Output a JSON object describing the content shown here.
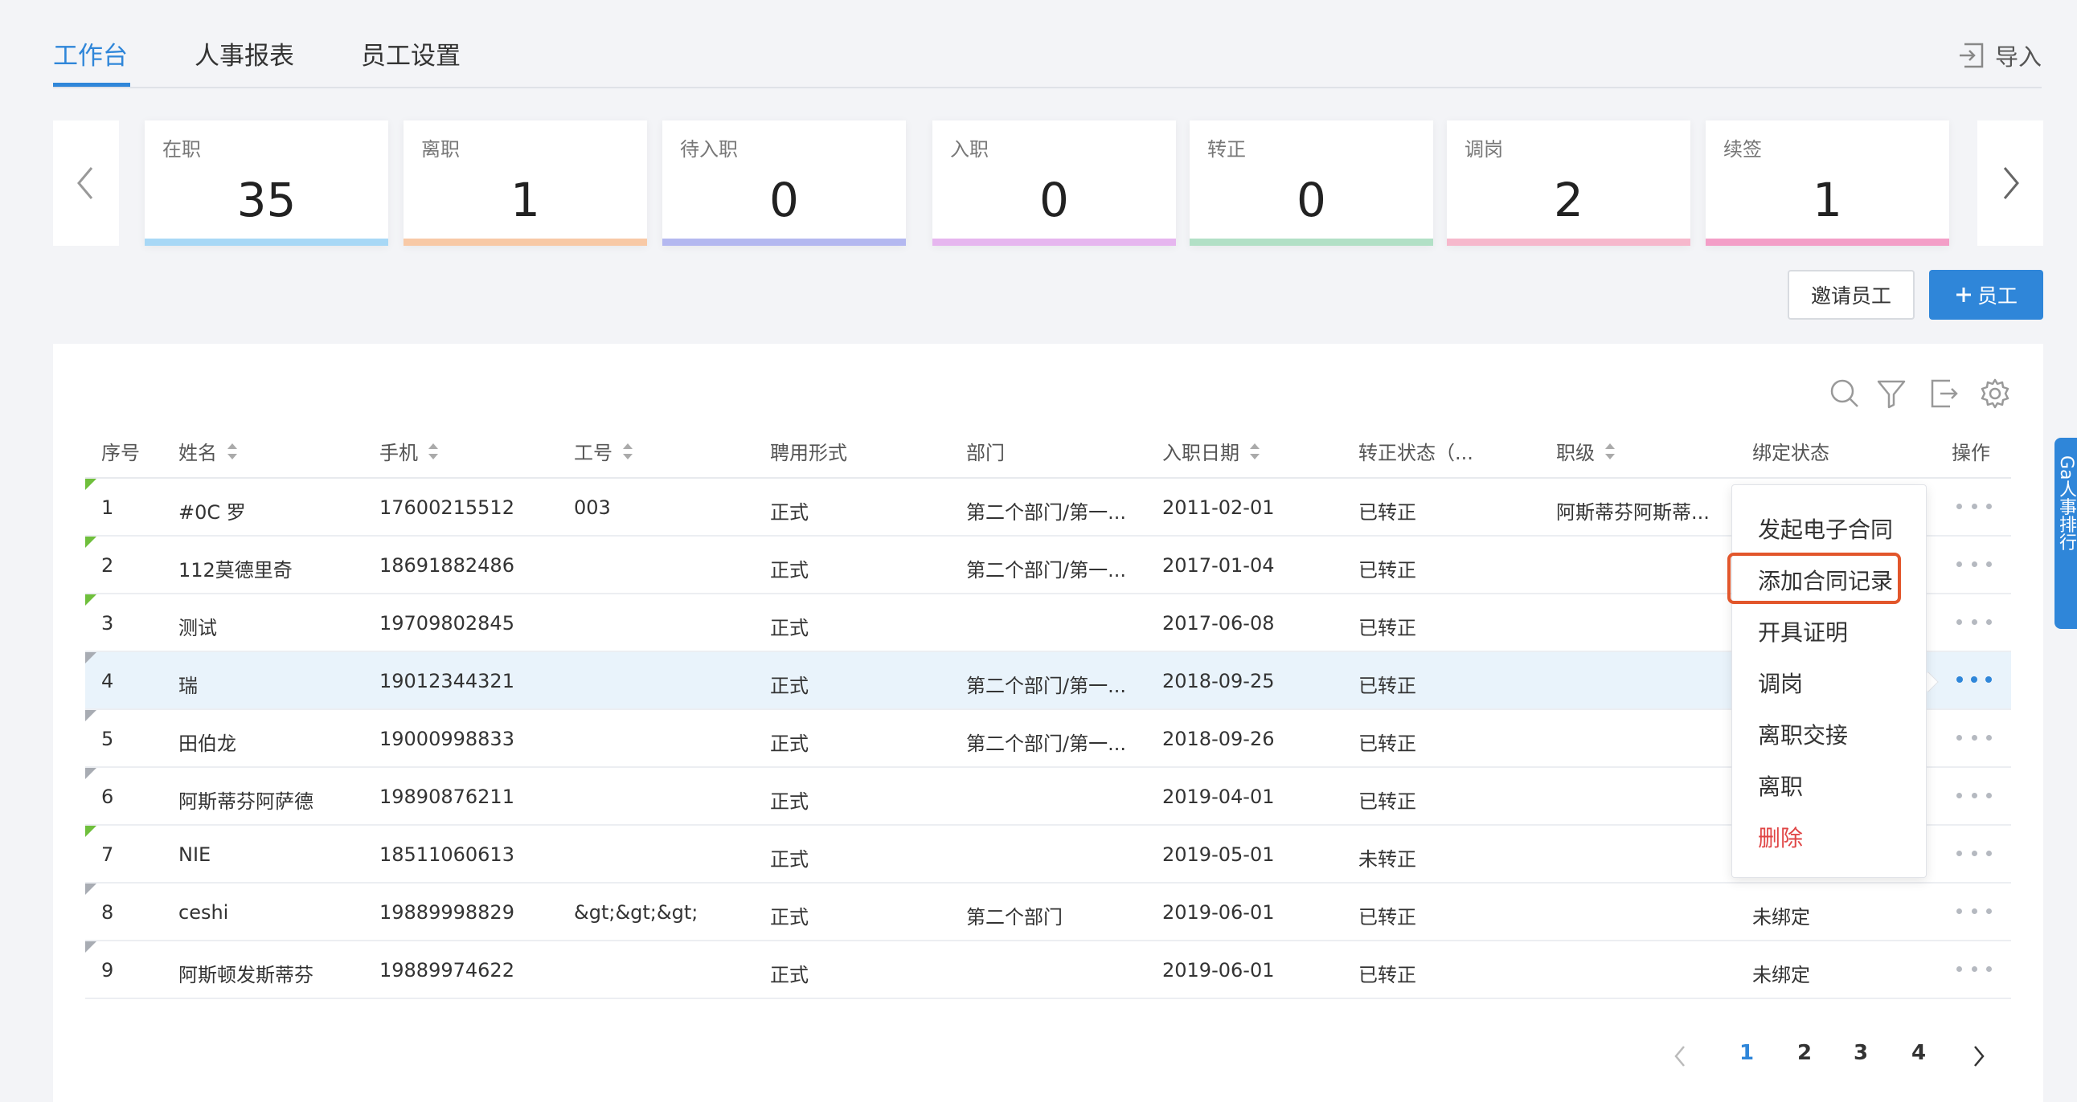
{
  "tabs": [
    {
      "label": "工作台",
      "active": true
    },
    {
      "label": "人事报表",
      "active": false
    },
    {
      "label": "员工设置",
      "active": false
    }
  ],
  "import_label": "导入",
  "stats": [
    {
      "label": "在职",
      "value": "35",
      "color": "#a8d8f6"
    },
    {
      "label": "离职",
      "value": "1",
      "color": "#f8c9a6"
    },
    {
      "label": "待入职",
      "value": "0",
      "color": "#b4b8f0"
    },
    {
      "label": "入职",
      "value": "0",
      "color": "#e6b6ef"
    },
    {
      "label": "转正",
      "value": "0",
      "color": "#b2e0c6"
    },
    {
      "label": "调岗",
      "value": "2",
      "color": "#f6b8cc"
    },
    {
      "label": "续签",
      "value": "1",
      "color": "#f39ec7"
    }
  ],
  "buttons": {
    "invite": "邀请员工",
    "add": "员工",
    "add_icon": "plus-icon"
  },
  "toolbar_icons": [
    "search-icon",
    "filter-icon",
    "export-icon",
    "settings-icon"
  ],
  "columns": [
    "序号",
    "姓名",
    "手机",
    "工号",
    "聘用形式",
    "部门",
    "入职日期",
    "转正状态（...",
    "职级",
    "绑定状态",
    "操作"
  ],
  "rows": [
    {
      "no": "1",
      "name": "#0C 罗",
      "phone": "17600215512",
      "id": "003",
      "type": "正式",
      "dept": "第二个部门/第一...",
      "date": "2011-02-01",
      "status": "已转正",
      "level": "阿斯蒂芬阿斯蒂...",
      "bind": "",
      "flag": "green"
    },
    {
      "no": "2",
      "name": "112莫德里奇",
      "phone": "18691882486",
      "id": "",
      "type": "正式",
      "dept": "第二个部门/第一...",
      "date": "2017-01-04",
      "status": "已转正",
      "level": "",
      "bind": "",
      "flag": "green"
    },
    {
      "no": "3",
      "name": "测试",
      "phone": "19709802845",
      "id": "",
      "type": "正式",
      "dept": "",
      "date": "2017-06-08",
      "status": "已转正",
      "level": "",
      "bind": "",
      "flag": "green"
    },
    {
      "no": "4",
      "name": "瑞",
      "phone": "19012344321",
      "id": "",
      "type": "正式",
      "dept": "第二个部门/第一...",
      "date": "2018-09-25",
      "status": "已转正",
      "level": "",
      "bind": "",
      "flag": "gray"
    },
    {
      "no": "5",
      "name": "田伯龙",
      "phone": "19000998833",
      "id": "",
      "type": "正式",
      "dept": "第二个部门/第一...",
      "date": "2018-09-26",
      "status": "已转正",
      "level": "",
      "bind": "",
      "flag": "gray"
    },
    {
      "no": "6",
      "name": "阿斯蒂芬阿萨德",
      "phone": "19890876211",
      "id": "",
      "type": "正式",
      "dept": "",
      "date": "2019-04-01",
      "status": "已转正",
      "level": "",
      "bind": "",
      "flag": "gray"
    },
    {
      "no": "7",
      "name": "NIE",
      "phone": "18511060613",
      "id": "",
      "type": "正式",
      "dept": "",
      "date": "2019-05-01",
      "status": "未转正",
      "level": "",
      "bind": "",
      "flag": "green"
    },
    {
      "no": "8",
      "name": "ceshi",
      "phone": "19889998829",
      "id": "&gt;&gt;&gt;",
      "type": "正式",
      "dept": "第二个部门",
      "date": "2019-06-01",
      "status": "已转正",
      "level": "",
      "bind": "未绑定",
      "flag": "gray"
    },
    {
      "no": "9",
      "name": "阿斯顿发斯蒂芬",
      "phone": "19889974622",
      "id": "",
      "type": "正式",
      "dept": "",
      "date": "2019-06-01",
      "status": "已转正",
      "level": "",
      "bind": "未绑定",
      "flag": "gray"
    }
  ],
  "menu": [
    "发起电子合同",
    "添加合同记录",
    "开具证明",
    "调岗",
    "离职交接",
    "离职",
    "删除"
  ],
  "pagination": {
    "pages": [
      "1",
      "2",
      "3",
      "4"
    ],
    "current": "1"
  },
  "float_tab": "Ga人事排行"
}
